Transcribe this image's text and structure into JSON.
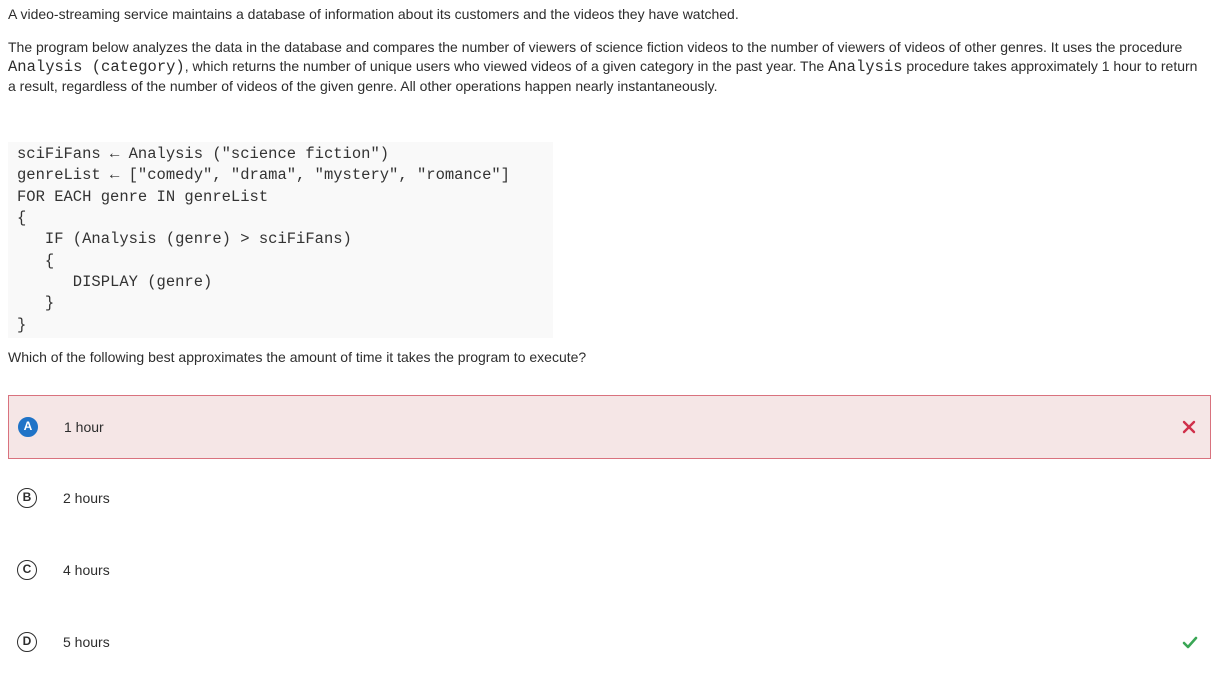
{
  "intro": "A video-streaming service maintains a database of information about its customers and the videos they have watched.",
  "paragraph": {
    "part1": "The program below analyzes the data in the database and compares the number of viewers of science fiction videos to the number of viewers of videos of other genres. It uses the procedure ",
    "code1": "Analysis (category)",
    "part2": ", which returns the number of unique users who viewed videos of a given category in the past year. The ",
    "code2": "Analysis",
    "part3": " procedure takes approximately 1 hour to return a result, regardless of the number of videos of the given genre. All other operations happen nearly instantaneously."
  },
  "code_lines": [
    "sciFiFans ← Analysis (\"science fiction\")",
    "genreList ← [\"comedy\", \"drama\", \"mystery\", \"romance\"]",
    "FOR EACH genre IN genreList",
    "{",
    "   IF (Analysis (genre) > sciFiFans)",
    "   {",
    "      DISPLAY (genre)",
    "   }",
    "}"
  ],
  "question": "Which of the following best approximates the amount of time it takes the program to execute?",
  "options": [
    {
      "letter": "A",
      "text": "1 hour",
      "state": "selected-wrong",
      "mark_icon": "x-icon"
    },
    {
      "letter": "B",
      "text": "2 hours",
      "state": "none",
      "mark_icon": ""
    },
    {
      "letter": "C",
      "text": "4 hours",
      "state": "none",
      "mark_icon": ""
    },
    {
      "letter": "D",
      "text": "5 hours",
      "state": "correct",
      "mark_icon": "check-icon"
    }
  ],
  "colors": {
    "selected_badge": "#1f73c7",
    "wrong_bg": "#f5e6e6",
    "wrong_border": "#d9727e",
    "wrong_mark": "#d0304a",
    "correct_mark": "#3aa655"
  }
}
